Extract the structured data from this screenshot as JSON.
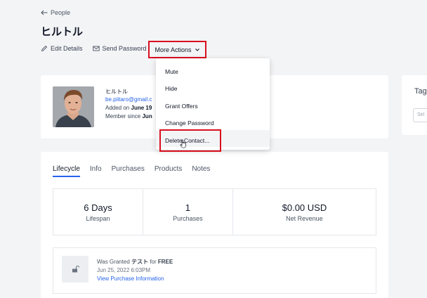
{
  "breadcrumb": {
    "back_label": "People"
  },
  "page": {
    "title": "ヒルトル"
  },
  "actions": {
    "edit_label": "Edit Details",
    "send_password_label": "Send Password",
    "more_actions_label": "More Actions"
  },
  "dropdown": {
    "items": [
      {
        "label": "Mute"
      },
      {
        "label": "Hide"
      },
      {
        "label": "Grant Offers"
      },
      {
        "label": "Change Password"
      },
      {
        "label": "Delete Contact..."
      }
    ]
  },
  "profile": {
    "name": "ヒルトル",
    "email": "be.piitaro@gmail.c",
    "added_prefix": "Added on",
    "added_value": "June 19",
    "member_prefix": "Member since",
    "member_value": "Jun"
  },
  "tags": {
    "title": "Tag",
    "select_placeholder": "Sel"
  },
  "tabs": [
    {
      "label": "Lifecycle",
      "active": true
    },
    {
      "label": "Info"
    },
    {
      "label": "Purchases"
    },
    {
      "label": "Products"
    },
    {
      "label": "Notes"
    }
  ],
  "stats": [
    {
      "value": "6 Days",
      "label": "Lifespan"
    },
    {
      "value": "1",
      "label": "Purchases"
    },
    {
      "value": "$0.00 USD",
      "label": "Net Revenue"
    }
  ],
  "purchase": {
    "granted_prefix": "Was Granted",
    "product": "テスト",
    "for_text": "for",
    "price": "FREE",
    "date": "Jun 25, 2022 6:03PM",
    "link_label": "View Purchase Information"
  },
  "colors": {
    "accent": "#2563eb",
    "highlight": "#d90f1f",
    "background": "#f3f4f6"
  }
}
